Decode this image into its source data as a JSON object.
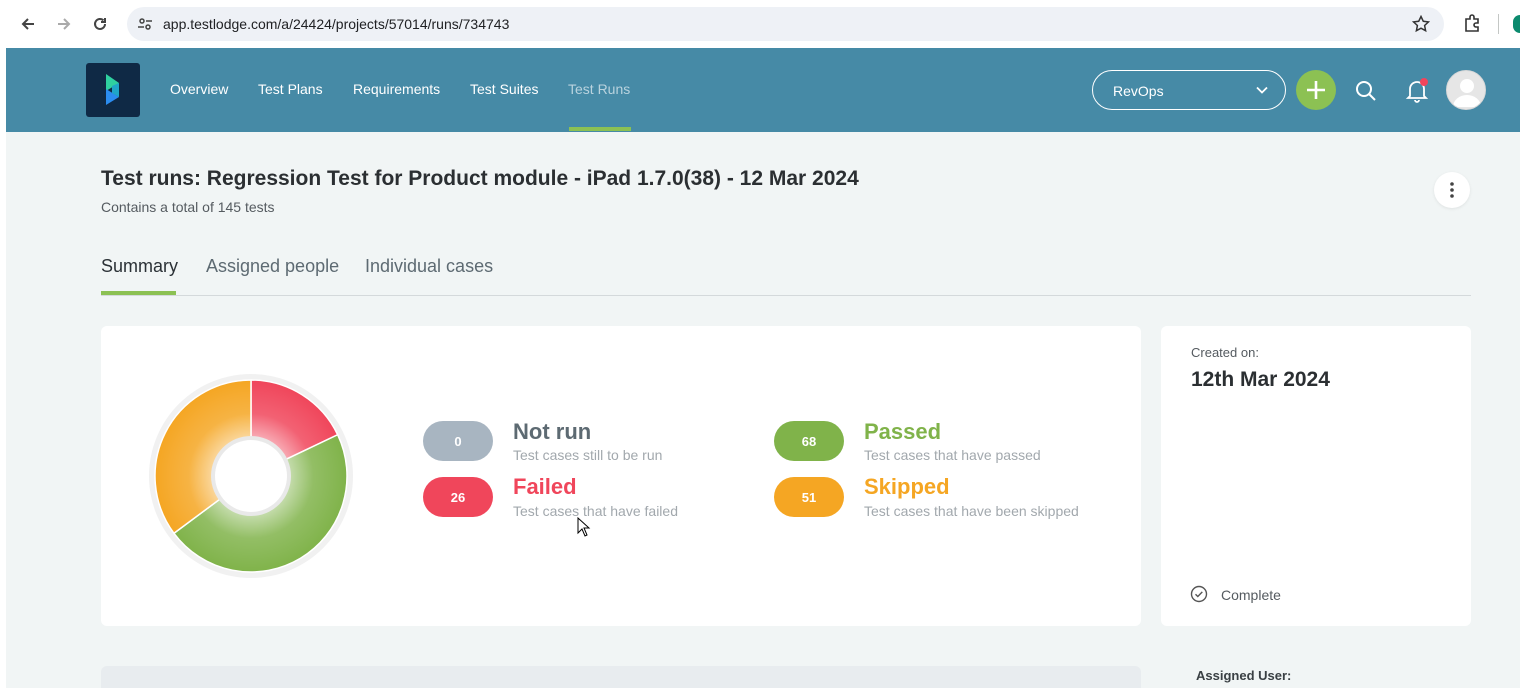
{
  "browser": {
    "url": "app.testlodge.com/a/24424/projects/57014/runs/734743"
  },
  "header": {
    "nav": [
      "Overview",
      "Test Plans",
      "Requirements",
      "Test Suites",
      "Test Runs"
    ],
    "active_nav": "Test Runs",
    "project_selector": "RevOps",
    "accent_color": "#8cc153",
    "header_color": "#468aa6"
  },
  "page": {
    "title": "Test runs: Regression Test for Product module - iPad 1.7.0(38) - 12 Mar 2024",
    "subtitle": "Contains a total of 145 tests"
  },
  "tabs": [
    {
      "label": "Summary",
      "active": true
    },
    {
      "label": "Assigned people",
      "active": false
    },
    {
      "label": "Individual cases",
      "active": false
    }
  ],
  "summary": {
    "stats": [
      {
        "key": "not_run",
        "count": "0",
        "title": "Not run",
        "desc": "Test cases still to be run",
        "color": "#a8b5c1",
        "title_color": "#5d6a72"
      },
      {
        "key": "failed",
        "count": "26",
        "title": "Failed",
        "desc": "Test cases that have failed",
        "color": "#f0465b",
        "title_color": "#f0465b"
      },
      {
        "key": "passed",
        "count": "68",
        "title": "Passed",
        "desc": "Test cases that have passed",
        "color": "#80b34a",
        "title_color": "#80b34a"
      },
      {
        "key": "skipped",
        "count": "51",
        "title": "Skipped",
        "desc": "Test cases that have been skipped",
        "color": "#f5a623",
        "title_color": "#f5a623"
      }
    ]
  },
  "details": {
    "created_label": "Created on:",
    "created_value": "12th Mar 2024",
    "status": "Complete",
    "assigned_user_label": "Assigned User:"
  },
  "chart_data": {
    "type": "pie",
    "categories": [
      "Failed",
      "Passed",
      "Skipped",
      "Not run"
    ],
    "values": [
      26,
      68,
      51,
      0
    ],
    "colors": [
      "#f0465b",
      "#80b34a",
      "#f5a623",
      "#a8b5c1"
    ],
    "donut": true
  }
}
